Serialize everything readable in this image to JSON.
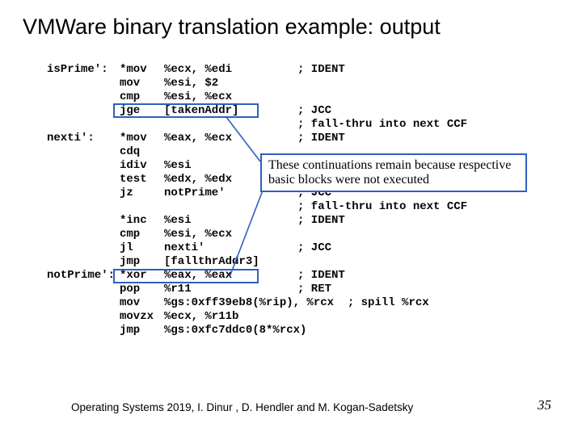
{
  "title": "VMWare binary translation example: output",
  "callout": "These continuations remain because respective basic blocks were not executed",
  "footer": "Operating Systems 2019, I. Dinur , D. Hendler and M. Kogan-Sadetsky",
  "page_number": "35",
  "code_rows": [
    {
      "label": "isPrime':",
      "op": "*mov",
      "arg": "%ecx, %edi",
      "cm": "; IDENT"
    },
    {
      "label": "",
      "op": "mov",
      "arg": "%esi, $2",
      "cm": ""
    },
    {
      "label": "",
      "op": "cmp",
      "arg": "%esi, %ecx",
      "cm": ""
    },
    {
      "label": "",
      "op": "jge",
      "arg": "[takenAddr]",
      "cm": "; JCC"
    },
    {
      "label": "",
      "op": "",
      "arg": "",
      "cm": "; fall-thru into next CCF"
    },
    {
      "label": "nexti':",
      "op": "*mov",
      "arg": "%eax, %ecx",
      "cm": "; IDENT"
    },
    {
      "label": "",
      "op": "cdq",
      "arg": "",
      "cm": ""
    },
    {
      "label": "",
      "op": "idiv",
      "arg": "%esi",
      "cm": ""
    },
    {
      "label": "",
      "op": "test",
      "arg": "%edx, %edx",
      "cm": ""
    },
    {
      "label": "",
      "op": "jz",
      "arg": "notPrime'",
      "cm": "; JCC"
    },
    {
      "label": "",
      "op": "",
      "arg": "",
      "cm": "; fall-thru into next CCF"
    },
    {
      "label": "",
      "op": "*inc",
      "arg": "%esi",
      "cm": "; IDENT"
    },
    {
      "label": "",
      "op": "cmp",
      "arg": "%esi, %ecx",
      "cm": ""
    },
    {
      "label": "",
      "op": "jl",
      "arg": "nexti'",
      "cm": "; JCC"
    },
    {
      "label": "",
      "op": "jmp",
      "arg": "[fallthrAddr3]",
      "cm": ""
    },
    {
      "label": "",
      "op": "",
      "arg": "",
      "cm": ""
    },
    {
      "label": "notPrime':",
      "op": "*xor",
      "arg": "%eax, %eax",
      "cm": "; IDENT"
    },
    {
      "label": "",
      "op": "pop",
      "arg": "%r11",
      "cm": "; RET"
    },
    {
      "label": "",
      "op": "mov",
      "arg": "%gs:0xff39eb8(%rip), %rcx  ; spill %rcx",
      "cm": ""
    },
    {
      "label": "",
      "op": "movzx",
      "arg": "%ecx, %r11b",
      "cm": ""
    },
    {
      "label": "",
      "op": "jmp",
      "arg": "%gs:0xfc7ddc0(8*%rcx)",
      "cm": ""
    }
  ]
}
